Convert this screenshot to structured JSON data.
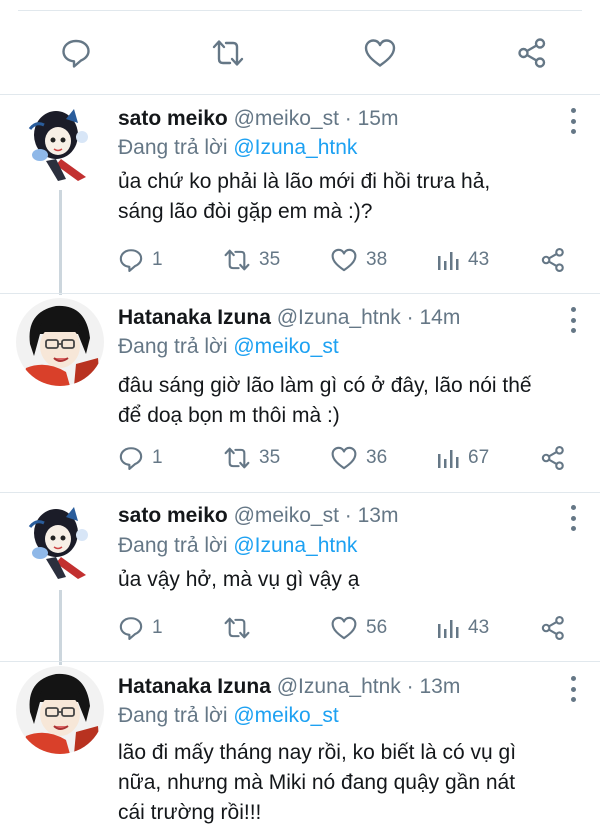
{
  "colors": {
    "accent": "#1da1f2",
    "secondary_text": "#657786",
    "text": "#14171a",
    "divider": "#e1e8ed"
  },
  "top_actions": [
    {
      "icon": "reply-icon"
    },
    {
      "icon": "retweet-icon"
    },
    {
      "icon": "like-icon"
    },
    {
      "icon": "share-icon"
    }
  ],
  "tweets": [
    {
      "name": "sato meiko",
      "handle": "@meiko_st",
      "time": " · 15m",
      "reply_prefix": "Đang trả lời ",
      "reply_to": "@Izuna_htnk",
      "text_lines": [
        "ủa chứ ko phải là lão mới đi hồi trưa hả,",
        "sáng lão đòi gặp em mà :)?"
      ],
      "replies": "1",
      "retweets": "35",
      "likes": "38",
      "views": "43"
    },
    {
      "name": "Hatanaka Izuna",
      "handle": "@Izuna_htnk",
      "time": " · 14m",
      "reply_prefix": "Đang trả lời ",
      "reply_to": "@meiko_st",
      "text_lines": [
        "đâu sáng giờ lão làm gì có ở đây, lão nói thế",
        "để doạ bọn m thôi mà :)"
      ],
      "replies": "1",
      "retweets": "35",
      "likes": "36",
      "views": "67"
    },
    {
      "name": "sato meiko",
      "handle": "@meiko_st",
      "time": " · 13m",
      "reply_prefix": "Đang trả lời ",
      "reply_to": "@Izuna_htnk",
      "text_lines": [
        "ủa vậy hở, mà vụ gì vậy ạ"
      ],
      "replies": "1",
      "retweets": "",
      "likes": "56",
      "views": "43"
    },
    {
      "name": "Hatanaka Izuna",
      "handle": "@Izuna_htnk",
      "time": " · 13m",
      "reply_prefix": "Đang trả lời ",
      "reply_to": "@meiko_st",
      "text_lines": [
        "lão đi mấy tháng nay rồi, ko biết là có vụ gì",
        "nữa, nhưng mà Miki nó đang quậy gần nát",
        "cái trường rồi!!!"
      ]
    }
  ]
}
